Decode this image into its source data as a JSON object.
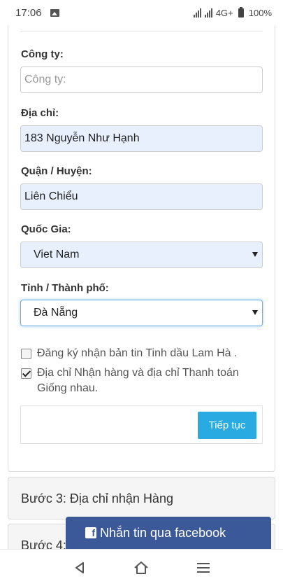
{
  "status_bar": {
    "time": "17:06",
    "network": "4G+",
    "battery": "100%"
  },
  "form": {
    "company": {
      "label": "Công ty:",
      "placeholder": "Công ty:",
      "value": ""
    },
    "address": {
      "label": "Địa chỉ:",
      "value": "183 Nguyễn Như Hạnh"
    },
    "district": {
      "label": "Quận / Huyện:",
      "value": "Liên Chiểu"
    },
    "country": {
      "label": "Quốc Gia:",
      "selected": "Viet Nam"
    },
    "province": {
      "label": "Tỉnh / Thành phố:",
      "selected": "Đà Nẵng"
    },
    "newsletter": {
      "label": "Đăng ký nhận bản tin Tinh dầu Lam Hà .",
      "checked": false
    },
    "same_address": {
      "line1": "Địa chỉ Nhận hàng và địa chỉ Thanh toán",
      "line2": "Giống nhau.",
      "checked": true
    },
    "continue_label": "Tiếp tục"
  },
  "steps": {
    "step3": "Bước 3: Địa chỉ nhận Hàng",
    "step4": "Bước 4:"
  },
  "facebook": {
    "label": "Nhắn tin qua facebook"
  },
  "nav": {
    "icons": [
      "back-icon",
      "home-icon",
      "menu-icon"
    ]
  }
}
